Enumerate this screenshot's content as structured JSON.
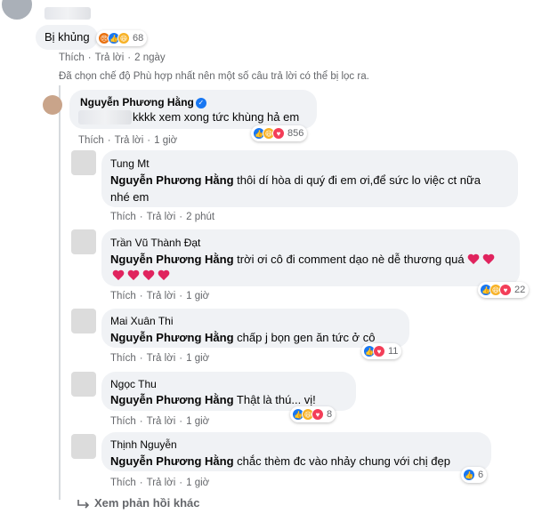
{
  "top_comment": {
    "text": "Bị khủng",
    "reaction_count": "68",
    "actions": {
      "like": "Thích",
      "reply": "Trả lời",
      "time": "2 ngày"
    }
  },
  "filter_notice": "Đã chọn chế độ Phù hợp nhất nên một số câu trả lời có thể bị lọc ra.",
  "main_reply": {
    "author": "Nguyễn Phương Hằng",
    "text": "kkkk xem xong tức khùng hả em",
    "reaction_count": "856",
    "actions": {
      "like": "Thích",
      "reply": "Trả lời",
      "time": "1 giờ"
    }
  },
  "replies": [
    {
      "author": "Tung Mt",
      "mention": "Nguyễn Phương Hằng",
      "text_line1": " thôi dí hòa di quý đi em ơi,để sức lo việc ct nữa",
      "text_line2": "nhé em",
      "reaction_count": "",
      "actions": {
        "like": "Thích",
        "reply": "Trả lời",
        "time": "2 phút"
      }
    },
    {
      "author": "Trần Vũ Thành Đạt",
      "mention": "Nguyễn Phương Hằng",
      "text_line1": " trời ơi cô đi comment dạo nè dễ thương quá",
      "reaction_count": "22",
      "actions": {
        "like": "Thích",
        "reply": "Trả lời",
        "time": "1 giờ"
      }
    },
    {
      "author": "Mai Xuân Thi",
      "mention": "Nguyễn Phương Hằng",
      "text_line1": " chấp j bọn gen ăn tức ở cô",
      "reaction_count": "11",
      "actions": {
        "like": "Thích",
        "reply": "Trả lời",
        "time": "1 giờ"
      }
    },
    {
      "author": "Ngọc Thu",
      "mention": "Nguyễn Phương Hằng",
      "text_line1": " Thật là thú... vị!",
      "reaction_count": "8",
      "actions": {
        "like": "Thích",
        "reply": "Trả lời",
        "time": "1 giờ"
      }
    },
    {
      "author": "Thịnh Nguyễn",
      "mention": "Nguyễn Phương Hằng",
      "text_line1": " chắc thèm đc vào nhảy chung với chị đẹp",
      "reaction_count": "6",
      "actions": {
        "like": "Thích",
        "reply": "Trả lời",
        "time": "1 giờ"
      }
    }
  ],
  "more_replies": "Xem phản hồi khác",
  "colors": {
    "bubble": "#f0f2f5",
    "meta_text": "#65676b",
    "like_blue": "#1877f2",
    "heart_red": "#e0245e"
  },
  "icons": [
    "like-icon",
    "angry-icon",
    "haha-icon",
    "love-icon",
    "verified-icon",
    "heart-icon",
    "reply-arrow-icon"
  ]
}
